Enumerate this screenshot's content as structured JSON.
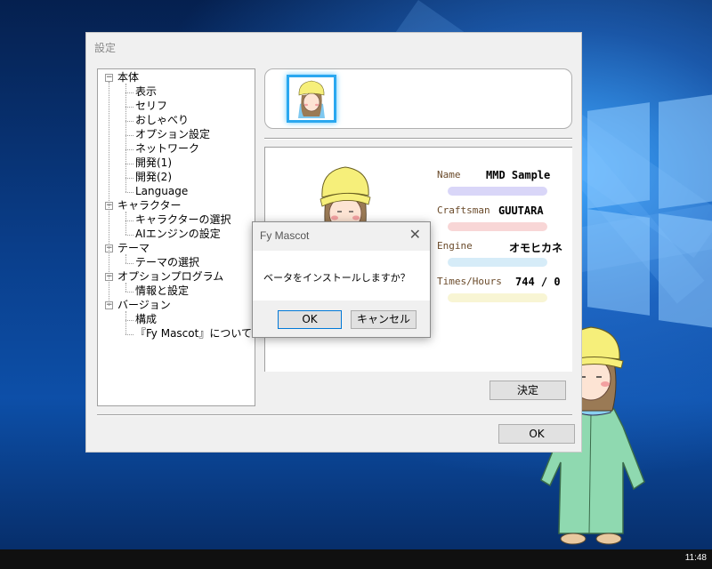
{
  "desktop": {
    "taskbar": {
      "clock": "11:48"
    }
  },
  "settings_window": {
    "title": "設定",
    "tree": [
      {
        "label": "本体",
        "level": 0,
        "toggle": "−"
      },
      {
        "label": "表示",
        "level": 1
      },
      {
        "label": "セリフ",
        "level": 1
      },
      {
        "label": "おしゃべり",
        "level": 1
      },
      {
        "label": "オプション設定",
        "level": 1
      },
      {
        "label": "ネットワーク",
        "level": 1
      },
      {
        "label": "開発(1)",
        "level": 1
      },
      {
        "label": "開発(2)",
        "level": 1
      },
      {
        "label": "Language",
        "level": 1
      },
      {
        "label": "キャラクター",
        "level": 0,
        "toggle": "−"
      },
      {
        "label": "キャラクターの選択",
        "level": 1
      },
      {
        "label": "AIエンジンの設定",
        "level": 1
      },
      {
        "label": "テーマ",
        "level": 0,
        "toggle": "−"
      },
      {
        "label": "テーマの選択",
        "level": 1
      },
      {
        "label": "オプションプログラム",
        "level": 0,
        "toggle": "−"
      },
      {
        "label": "情報と設定",
        "level": 1
      },
      {
        "label": "バージョン",
        "level": 0,
        "toggle": "−"
      },
      {
        "label": "構成",
        "level": 1
      },
      {
        "label": "『Fy Mascot』について",
        "level": 1
      }
    ],
    "character_info": {
      "name_label": "Name",
      "name_value": "MMD Sample",
      "craftsman_label": "Craftsman",
      "craftsman_value": "GUUTARA",
      "engine_label": "Engine",
      "engine_value": "オモヒカネ",
      "times_label": "Times/Hours",
      "times_value": "744 / 0"
    },
    "decide_button": "決定",
    "ok_button": "OK"
  },
  "dialog": {
    "title": "Fy Mascot",
    "close_glyph": "✕",
    "message": "ベータをインストールしますか？",
    "ok_button": "OK",
    "cancel_button": "キャンセル"
  },
  "colors": {
    "accent_thumb_border": "#2aa8f0",
    "bar_name": "#b9b4f2",
    "bar_craftsman": "#f2b4b4",
    "bar_engine": "#b4dcf2",
    "bar_times": "#f2ecb0"
  }
}
